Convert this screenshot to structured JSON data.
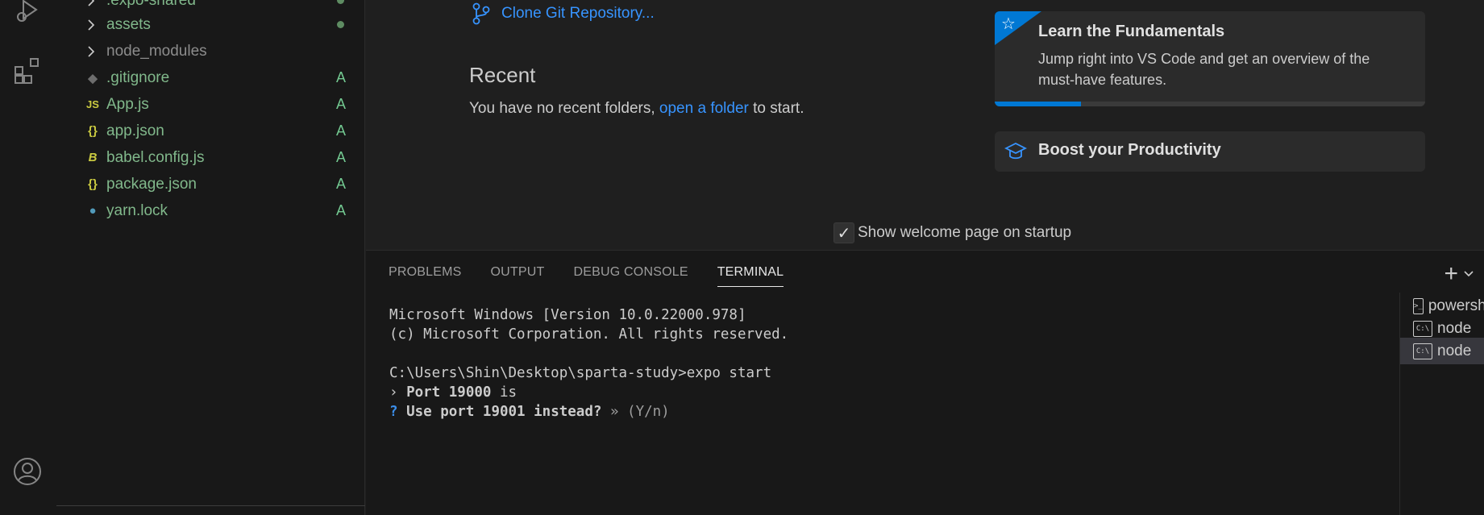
{
  "explorer": {
    "items": [
      {
        "label": ".expo-shared",
        "type": "folder",
        "status": "dot"
      },
      {
        "label": "assets",
        "type": "folder",
        "status": "dot"
      },
      {
        "label": "node_modules",
        "type": "folder",
        "status": ""
      },
      {
        "label": ".gitignore",
        "type": "git",
        "status": "A"
      },
      {
        "label": "App.js",
        "type": "js",
        "icon_text": "JS",
        "status": "A"
      },
      {
        "label": "app.json",
        "type": "json",
        "icon_text": "{}",
        "status": "A"
      },
      {
        "label": "babel.config.js",
        "type": "babel",
        "icon_text": "B",
        "status": "A"
      },
      {
        "label": "package.json",
        "type": "json",
        "icon_text": "{}",
        "status": "A"
      },
      {
        "label": "yarn.lock",
        "type": "yarn",
        "status": "A"
      }
    ]
  },
  "welcome": {
    "clone_label": "Clone Git Repository...",
    "recent_title": "Recent",
    "recent_prefix": "You have no recent folders,",
    "recent_link": "open a folder",
    "recent_suffix": "to start.",
    "walkthroughs": [
      {
        "title": "Learn the Fundamentals",
        "description": "Jump right into VS Code and get an overview of the must-have features.",
        "progress": 0.2
      },
      {
        "title": "Boost your Productivity"
      }
    ],
    "startup_label": "Show welcome page on startup",
    "startup_checked": true
  },
  "panel": {
    "tabs": [
      "PROBLEMS",
      "OUTPUT",
      "DEBUG CONSOLE",
      "TERMINAL"
    ],
    "active_tab": "TERMINAL",
    "terminal_lines": {
      "l1": "Microsoft Windows [Version 10.0.22000.978]",
      "l2": "(c) Microsoft Corporation. All rights reserved.",
      "l3": "C:\\Users\\Shin\\Desktop\\sparta-study>expo start",
      "l4_prefix": "› ",
      "l4_bold": "Port 19000",
      "l4_suffix": " is",
      "l5_q": "?",
      "l5_bold": "Use port 19001 instead?",
      "l5_hint": "» (Y/n)"
    },
    "terminals": [
      {
        "label": "powershell",
        "icon_text": "",
        "selected": false
      },
      {
        "label": "node",
        "icon_text": "C:\\",
        "selected": false
      },
      {
        "label": "node",
        "icon_text": "C:\\",
        "selected": true
      }
    ]
  },
  "colors": {
    "accent": "#0078d4",
    "link": "#3794ff",
    "git_added": "#73c991"
  }
}
